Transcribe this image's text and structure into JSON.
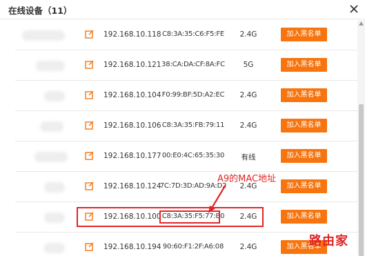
{
  "dialog": {
    "title": "在线设备（11）",
    "close_icon": "close-icon"
  },
  "devices": [
    {
      "ip": "192.168.10.118",
      "mac": "C8:3A:35:C6:F5:FE",
      "band": "2.4G",
      "action": "加入黑名单"
    },
    {
      "ip": "192.168.10.121",
      "mac": "38:CA:DA:CF:8A:FC",
      "band": "5G",
      "action": "加入黑名单"
    },
    {
      "ip": "192.168.10.104",
      "mac": "F0:99:BF:5D:A2:EC",
      "band": "2.4G",
      "action": "加入黑名单"
    },
    {
      "ip": "192.168.10.106",
      "mac": "C8:3A:35:FB:79:11",
      "band": "2.4G",
      "action": "加入黑名单"
    },
    {
      "ip": "192.168.10.177",
      "mac": "00:E0:4C:65:35:30",
      "band": "有线",
      "action": "加入黑名单"
    },
    {
      "ip": "192.168.10.124",
      "mac": "7C:7D:3D:AD:9A:D2",
      "band": "2.4G",
      "action": "加入黑名单"
    },
    {
      "ip": "192.168.10.100",
      "mac": "C8:3A:35:F5:77:B0",
      "band": "2.4G",
      "action": "加入黑名单"
    },
    {
      "ip": "192.168.10.194",
      "mac": "90:60:F1:2F:A6:08",
      "band": "2.4G",
      "action": "加入黑名单"
    }
  ],
  "annotation": {
    "label": "A9的MAC地址",
    "color": "#e02424"
  },
  "watermark": "路由家",
  "colors": {
    "accent": "#f7740f",
    "highlight": "#e02424"
  },
  "icons": {
    "edit": "edit-icon"
  }
}
